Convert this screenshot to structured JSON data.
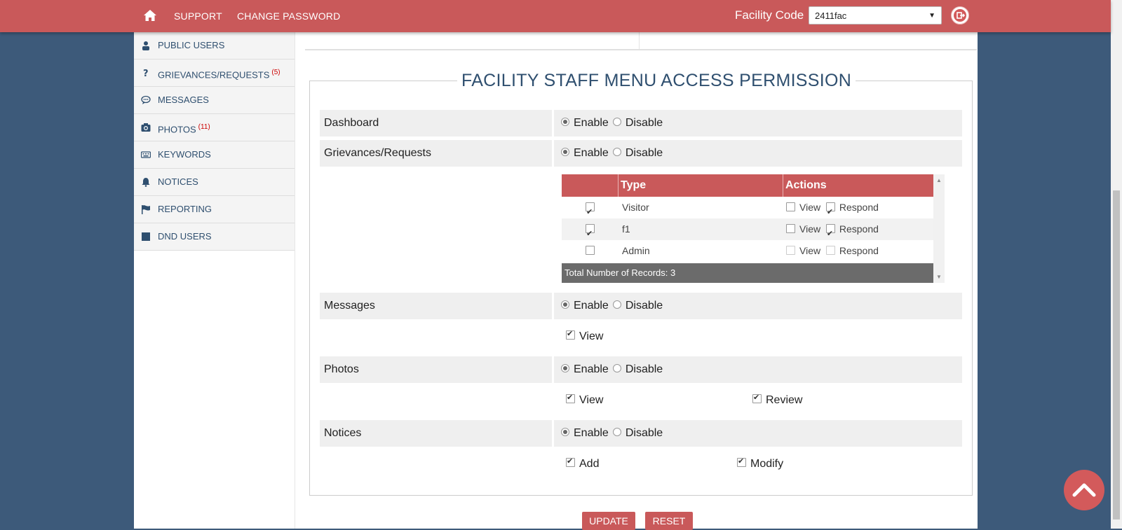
{
  "topbar": {
    "nav": [
      "SUPPORT",
      "CHANGE PASSWORD"
    ],
    "facility_label": "Facility Code",
    "facility_value": "2411fac"
  },
  "sidebar": {
    "items": [
      {
        "label": "PUBLIC USERS",
        "icon": "users-icon",
        "badge": ""
      },
      {
        "label": "GRIEVANCES/REQUESTS",
        "icon": "question-icon",
        "badge": "(5)"
      },
      {
        "label": "MESSAGES",
        "icon": "chat-icon",
        "badge": ""
      },
      {
        "label": "PHOTOS",
        "icon": "camera-icon",
        "badge": "(11)"
      },
      {
        "label": "KEYWORDS",
        "icon": "keyboard-icon",
        "badge": ""
      },
      {
        "label": "NOTICES",
        "icon": "bell-icon",
        "badge": ""
      },
      {
        "label": "REPORTING",
        "icon": "flag-icon",
        "badge": ""
      },
      {
        "label": "DND USERS",
        "icon": "square-icon",
        "badge": ""
      }
    ]
  },
  "panel": {
    "title": "FACILITY STAFF MENU ACCESS PERMISSION",
    "enable": "Enable",
    "disable": "Disable",
    "rows": {
      "dashboard": "Dashboard",
      "grievances": "Grievances/Requests",
      "messages": "Messages",
      "photos": "Photos",
      "notices": "Notices"
    },
    "messages_opts": {
      "view": "View"
    },
    "photos_opts": {
      "view": "View",
      "review": "Review"
    },
    "notices_opts": {
      "add": "Add",
      "modify": "Modify"
    }
  },
  "grievance_table": {
    "headers": {
      "type": "Type",
      "actions": "Actions"
    },
    "rows": [
      {
        "type": "Visitor",
        "view": "View",
        "respond": "Respond"
      },
      {
        "type": "f1",
        "view": "View",
        "respond": "Respond"
      },
      {
        "type": "Admin",
        "view": "View",
        "respond": "Respond"
      }
    ],
    "footer": "Total Number of Records: 3"
  },
  "buttons": {
    "update": "UPDATE",
    "reset": "RESET"
  },
  "colors": {
    "brand": "#c9595a",
    "background": "#3d5a7a",
    "text_accent": "#2f4f6f"
  }
}
